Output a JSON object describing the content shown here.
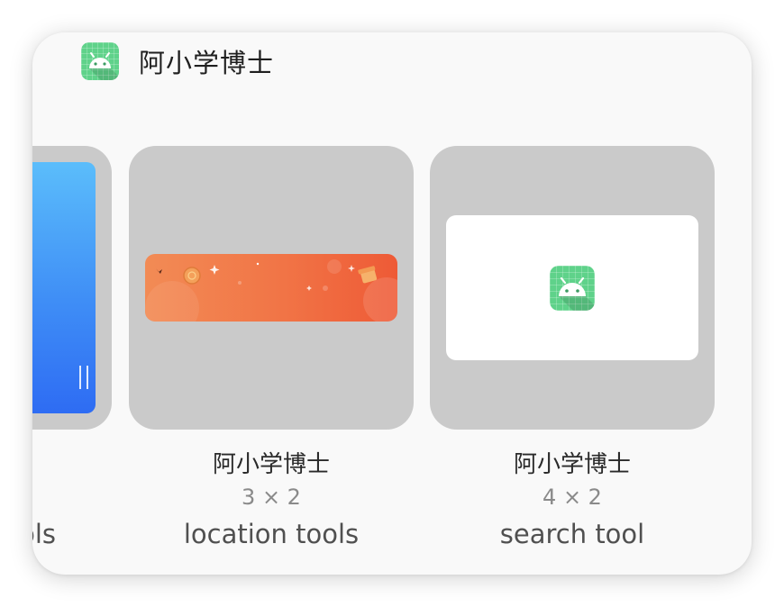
{
  "app": {
    "name": "阿小学博士",
    "icon": "android-robot-icon"
  },
  "widgets": [
    {
      "name": "",
      "size": "",
      "description": "ols",
      "preview": "blue-gradient-panel"
    },
    {
      "name": "阿小学博士",
      "size": "3 × 2",
      "description": "location tools",
      "preview": "orange-banner"
    },
    {
      "name": "阿小学博士",
      "size": "4 × 2",
      "description": "search tool",
      "preview": "app-icon-on-white"
    }
  ],
  "colors": {
    "sheet_background": "#f9f9f9",
    "card_background": "#cacaca",
    "app_icon_green": "#5fd28a",
    "banner_orange": "#f17446",
    "preview_blue": "#3f8ef6"
  }
}
